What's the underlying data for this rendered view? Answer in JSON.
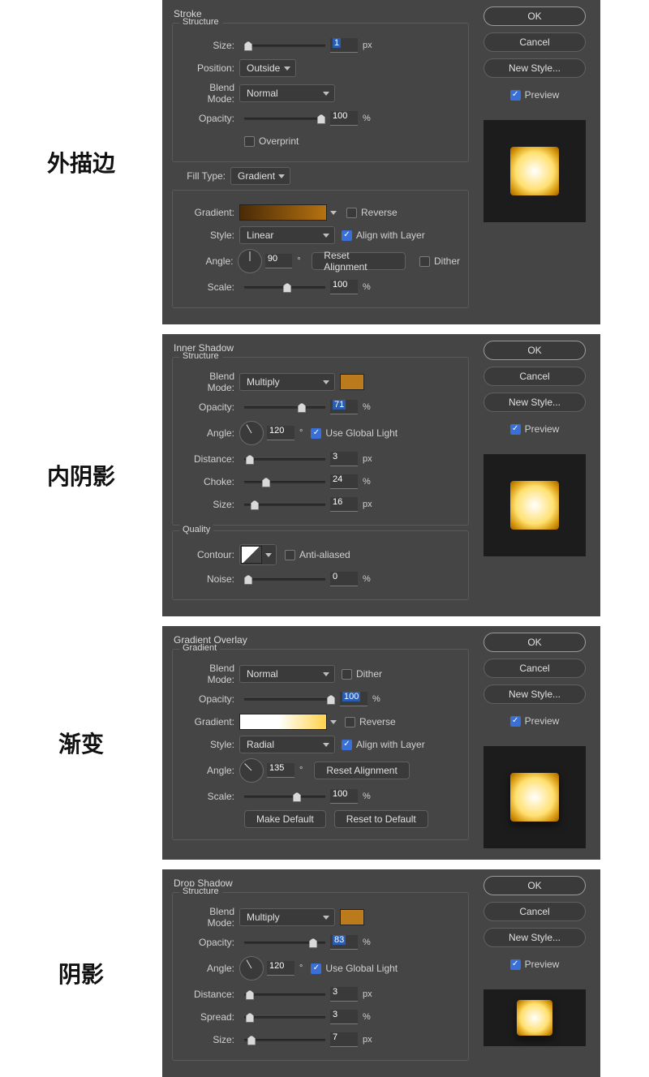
{
  "common": {
    "ok": "OK",
    "cancel": "Cancel",
    "newStyle": "New Style...",
    "preview": "Preview",
    "structure": "Structure",
    "quality": "Quality"
  },
  "labels": {
    "size": "Size:",
    "position": "Position:",
    "blendMode": "Blend Mode:",
    "opacity": "Opacity:",
    "fillType": "Fill Type:",
    "gradient": "Gradient:",
    "style": "Style:",
    "angle": "Angle:",
    "scale": "Scale:",
    "distance": "Distance:",
    "choke": "Choke:",
    "spread": "Spread:",
    "contour": "Contour:",
    "noise": "Noise:"
  },
  "units": {
    "px": "px",
    "pct": "%",
    "deg": "°"
  },
  "chinese": {
    "stroke": "外描边",
    "inner": "内阴影",
    "gradient": "渐变",
    "shadow": "阴影"
  },
  "stroke": {
    "title": "Stroke",
    "size": "1",
    "position": "Outside",
    "blendMode": "Normal",
    "opacity": "100",
    "overprint": "Overprint",
    "fillType": "Gradient",
    "reverse": "Reverse",
    "style": "Linear",
    "alignWithLayer": "Align with Layer",
    "angle": "90",
    "resetAlignment": "Reset Alignment",
    "dither": "Dither",
    "scale": "100",
    "gradientColors": [
      "#4a2a07",
      "#b57210"
    ]
  },
  "innerShadow": {
    "title": "Inner Shadow",
    "blendMode": "Multiply",
    "color": "#bb7a1b",
    "opacity": "71",
    "angle": "120",
    "useGlobalLight": "Use Global Light",
    "distance": "3",
    "choke": "24",
    "size": "16",
    "antiAliased": "Anti-aliased",
    "noise": "0"
  },
  "gradientOverlay": {
    "title": "Gradient Overlay",
    "section": "Gradient",
    "blendMode": "Normal",
    "dither": "Dither",
    "opacity": "100",
    "reverse": "Reverse",
    "style": "Radial",
    "alignWithLayer": "Align with Layer",
    "angle": "135",
    "resetAlignment": "Reset Alignment",
    "scale": "100",
    "makeDefault": "Make Default",
    "resetDefault": "Reset to Default",
    "gradientColors": [
      "#ffffff",
      "#ffd24a"
    ]
  },
  "dropShadow": {
    "title": "Drop Shadow",
    "blendMode": "Multiply",
    "color": "#bb7a1b",
    "opacity": "83",
    "angle": "120",
    "useGlobalLight": "Use Global Light",
    "distance": "3",
    "spread": "3",
    "size": "7"
  }
}
